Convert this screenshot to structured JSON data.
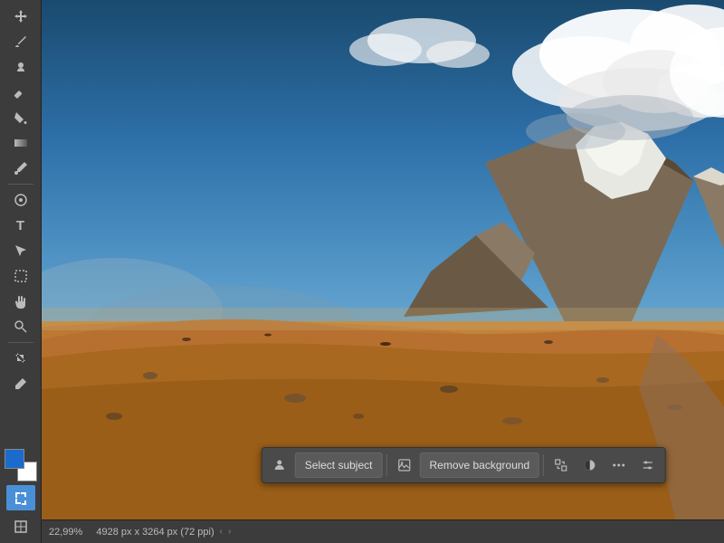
{
  "toolbar": {
    "tools": [
      {
        "name": "move-tool",
        "icon": "✛",
        "active": false
      },
      {
        "name": "brush-tool",
        "icon": "✏",
        "active": false
      },
      {
        "name": "stamp-tool",
        "icon": "👤",
        "active": false
      },
      {
        "name": "eraser-tool",
        "icon": "◻",
        "active": false
      },
      {
        "name": "clone-tool",
        "icon": "⊕",
        "active": false
      },
      {
        "name": "paint-bucket-tool",
        "icon": "⬡",
        "active": false
      },
      {
        "name": "gradient-tool",
        "icon": "◑",
        "active": false
      },
      {
        "name": "eyedropper-tool",
        "icon": "○",
        "active": false
      },
      {
        "name": "text-tool",
        "icon": "T",
        "active": false
      },
      {
        "name": "selection-tool",
        "icon": "↖",
        "active": false
      },
      {
        "name": "rect-select-tool",
        "icon": "▭",
        "active": false
      },
      {
        "name": "hand-tool",
        "icon": "✋",
        "active": false
      },
      {
        "name": "zoom-tool",
        "icon": "🔍",
        "active": false
      },
      {
        "name": "crop-tool",
        "icon": "⌗",
        "active": false
      },
      {
        "name": "pen-tool",
        "icon": "✒",
        "active": false
      },
      {
        "name": "transform-tool",
        "icon": "↔",
        "active": true
      }
    ]
  },
  "floating_toolbar": {
    "select_subject_label": "Select subject",
    "remove_background_label": "Remove background",
    "select_subject_icon": "👤",
    "remove_background_icon": "🖼"
  },
  "statusbar": {
    "zoom": "22,99%",
    "dimensions": "4928 px x 3264 px (72 ppi)",
    "arrow_left": "‹",
    "arrow_right": "›"
  }
}
